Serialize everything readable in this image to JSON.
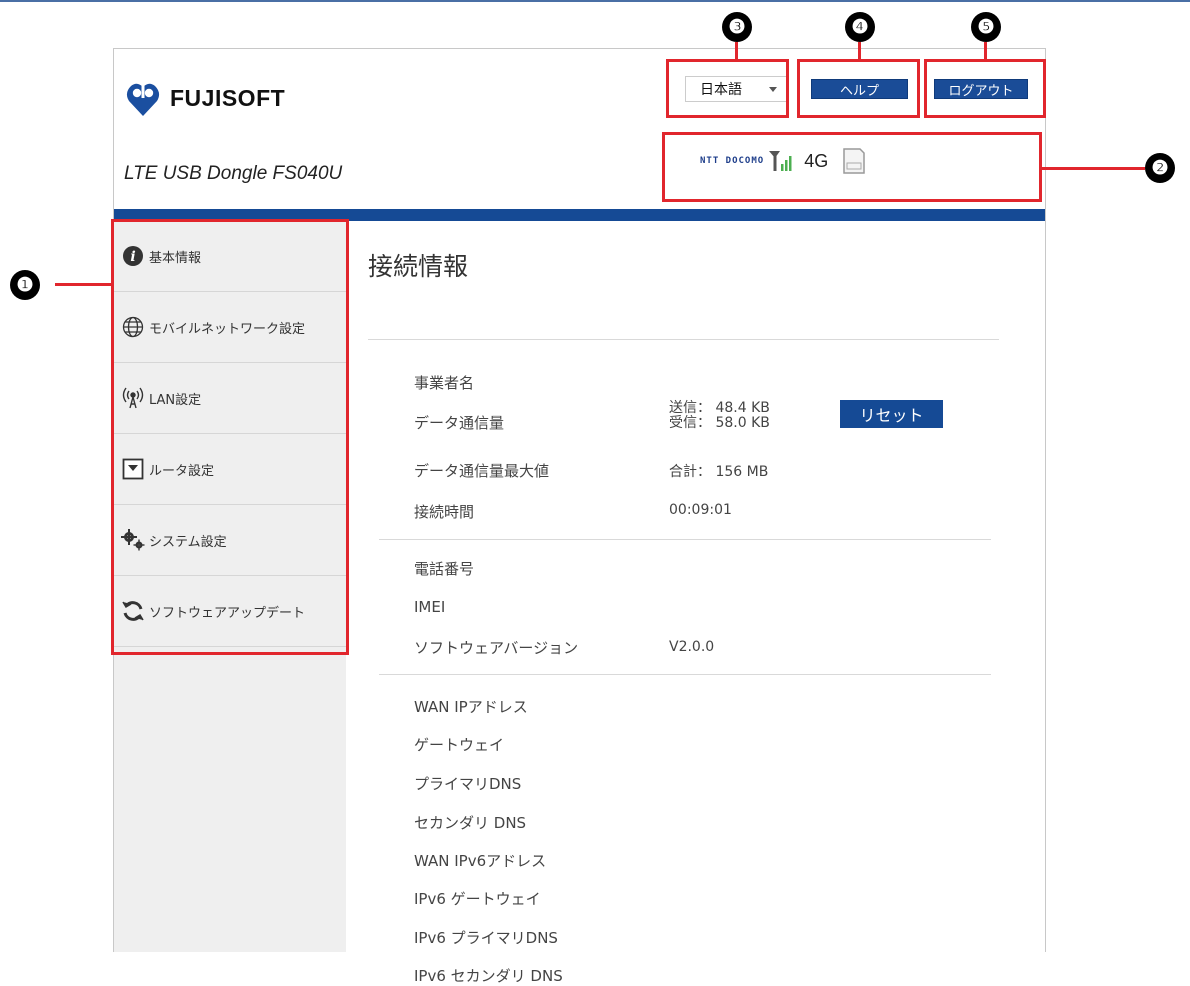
{
  "brand": {
    "logo_text": "FUJISOFT",
    "product": "LTE USB Dongle FS040U"
  },
  "header": {
    "language": "日本語",
    "help_label": "ヘルプ",
    "logout_label": "ログアウト",
    "status": {
      "carrier": "NTT DOCOMO",
      "network_type": "4G"
    }
  },
  "sidebar": {
    "items": [
      {
        "label": "基本情報",
        "icon": "info-icon"
      },
      {
        "label": "モバイルネットワーク設定",
        "icon": "globe-icon"
      },
      {
        "label": "LAN設定",
        "icon": "wireless-icon"
      },
      {
        "label": "ルータ設定",
        "icon": "router-icon"
      },
      {
        "label": "システム設定",
        "icon": "gears-icon"
      },
      {
        "label": "ソフトウェアアップデート",
        "icon": "refresh-icon"
      }
    ]
  },
  "main": {
    "title": "接続情報",
    "section1": {
      "operator_label": "事業者名",
      "data_usage_label": "データ通信量",
      "sent": "送信： 48.4 KB",
      "received": "受信： 58.0 KB",
      "reset_label": "リセット",
      "data_max_label": "データ通信量最大値",
      "data_max_value": "合計： 156 MB",
      "connect_time_label": "接続時間",
      "connect_time_value": "00:09:01"
    },
    "section2": {
      "phone_label": "電話番号",
      "imei_label": "IMEI",
      "software_version_label": "ソフトウェアバージョン",
      "software_version_value": "V2.0.0"
    },
    "section3": {
      "wan_ip_label": "WAN IPアドレス",
      "gateway_label": "ゲートウェイ",
      "primary_dns_label": "プライマリDNS",
      "secondary_dns_label": "セカンダリ DNS",
      "wan_ipv6_label": "WAN IPv6アドレス",
      "ipv6_gateway_label": "IPv6 ゲートウェイ",
      "ipv6_primary_dns_label": "IPv6 プライマリDNS",
      "ipv6_secondary_dns_label": "IPv6 セカンダリ DNS"
    }
  },
  "callouts": [
    "❶",
    "❷",
    "❸",
    "❹",
    "❺"
  ],
  "colors": {
    "accent": "#154a95",
    "highlight": "#e1262d",
    "sidebar_bg": "#efefef",
    "signal": "#4caf50"
  }
}
